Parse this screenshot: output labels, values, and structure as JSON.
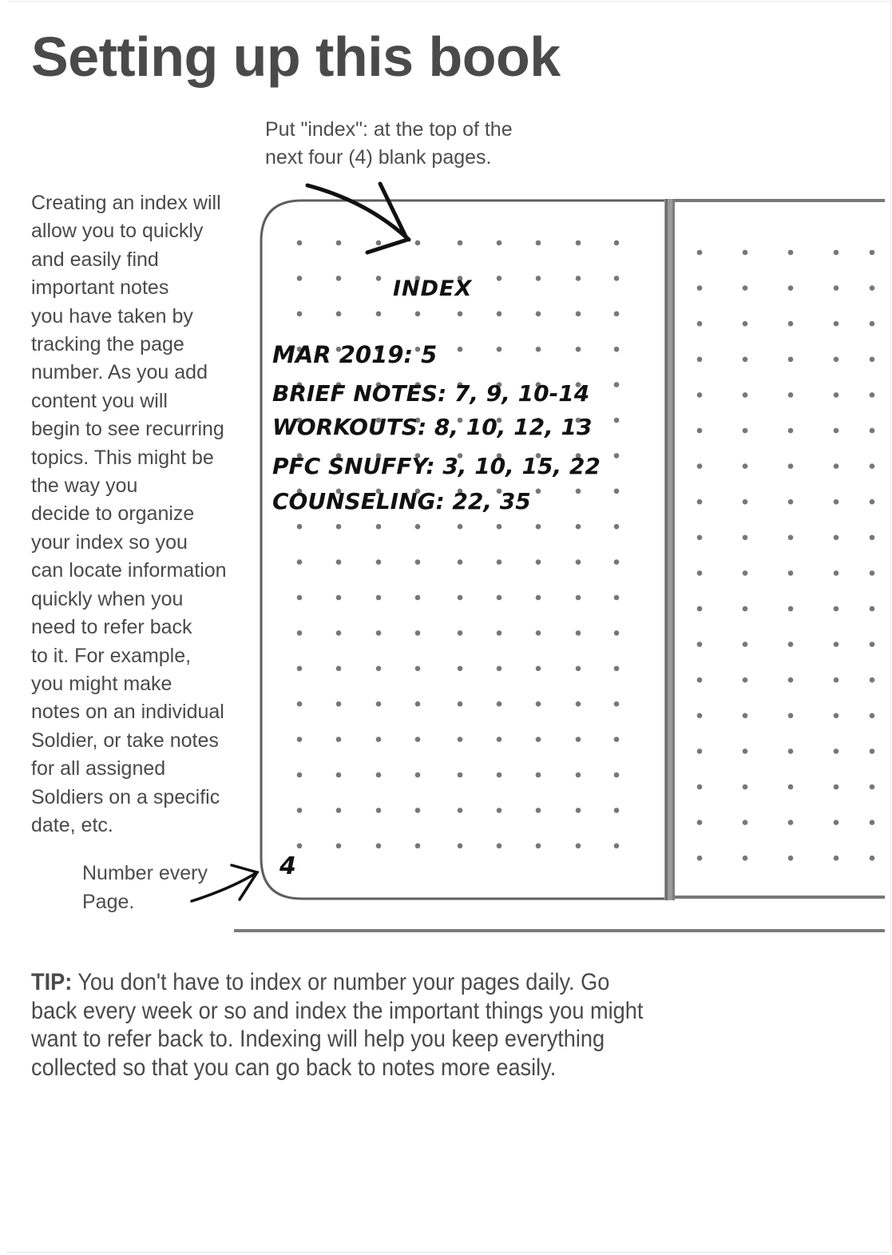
{
  "page": {
    "title": "Setting up this book"
  },
  "callouts": {
    "top": [
      "Put \"index\": at the top of the",
      "next four (4) blank pages."
    ],
    "bottom": [
      "Number every",
      "Page."
    ]
  },
  "body_lines": [
    "Creating an index will",
    "allow you to quickly",
    "and easily find",
    "important notes",
    "you have taken by",
    "tracking the page",
    "number. As you add",
    "content you will",
    "begin to see recurring",
    "topics. This might be",
    "the way you",
    "decide to organize",
    "your index so you",
    "can locate information",
    "quickly when you",
    "need to refer back",
    "to it. For example,",
    "you might make",
    "notes on an individual",
    "Soldier, or take notes",
    "for all assigned",
    "Soldiers on a specific",
    "date, etc."
  ],
  "notebook": {
    "heading": "INDEX",
    "entries": [
      "MAR 2019: 5",
      "BRIEF NOTES: 7, 9, 10-14",
      "WORKOUTS: 8, 10, 12, 13",
      "PFC SNUFFY: 3, 10, 15, 22",
      "COUNSELING: 22, 35"
    ],
    "page_number": "4"
  },
  "tip": {
    "label": "TIP:",
    "lines": [
      " You don't have to index or number your pages daily. Go",
      "back every week or so and index the important things you might",
      "want to refer back to. Indexing will help you keep everything",
      "collected so that you can go back to notes more easily."
    ]
  },
  "colors": {
    "text": "#4a4a4a",
    "dot": "#777777",
    "ink": "#111111",
    "border": "#666666"
  }
}
